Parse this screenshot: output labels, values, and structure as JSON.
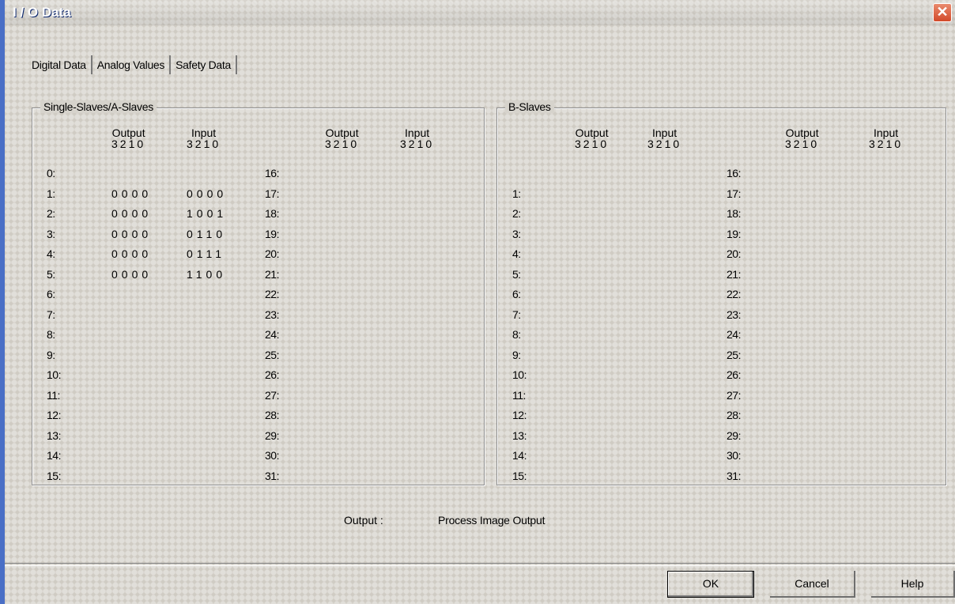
{
  "window": {
    "title": "I / O Data",
    "close_glyph": "✕"
  },
  "tabs": [
    "Digital Data",
    "Analog Values",
    "Safety Data"
  ],
  "group_a": {
    "title": "Single-Slaves/A-Slaves",
    "headers": {
      "output": "Output",
      "input": "Input",
      "bits": "3210"
    },
    "left_rows": [
      "0:",
      "1:",
      "2:",
      "3:",
      "4:",
      "5:",
      "6:",
      "7:",
      "8:",
      "9:",
      "10:",
      "11:",
      "12:",
      "13:",
      "14:",
      "15:"
    ],
    "right_rows": [
      "16:",
      "17:",
      "18:",
      "19:",
      "20:",
      "21:",
      "22:",
      "23:",
      "24:",
      "25:",
      "26:",
      "27:",
      "28:",
      "29:",
      "30:",
      "31:"
    ],
    "values": [
      {
        "output": "",
        "input": ""
      },
      {
        "output": "0000",
        "input": "0000"
      },
      {
        "output": "0000",
        "input": "1001"
      },
      {
        "output": "0000",
        "input": "0110"
      },
      {
        "output": "0000",
        "input": "0111"
      },
      {
        "output": "0000",
        "input": "1100"
      }
    ]
  },
  "group_b": {
    "title": "B-Slaves",
    "headers": {
      "output": "Output",
      "input": "Input",
      "bits": "3210"
    },
    "left_rows": [
      "",
      "1:",
      "2:",
      "3:",
      "4:",
      "5:",
      "6:",
      "7:",
      "8:",
      "9:",
      "10:",
      "11:",
      "12:",
      "13:",
      "14:",
      "15:"
    ],
    "right_rows": [
      "16:",
      "17:",
      "18:",
      "19:",
      "20:",
      "21:",
      "22:",
      "23:",
      "24:",
      "25:",
      "26:",
      "27:",
      "28:",
      "29:",
      "30:",
      "31:"
    ]
  },
  "legend": {
    "label": "Output :",
    "value": "Process Image Output"
  },
  "buttons": {
    "ok": "OK",
    "cancel": "Cancel",
    "help": "Help"
  }
}
